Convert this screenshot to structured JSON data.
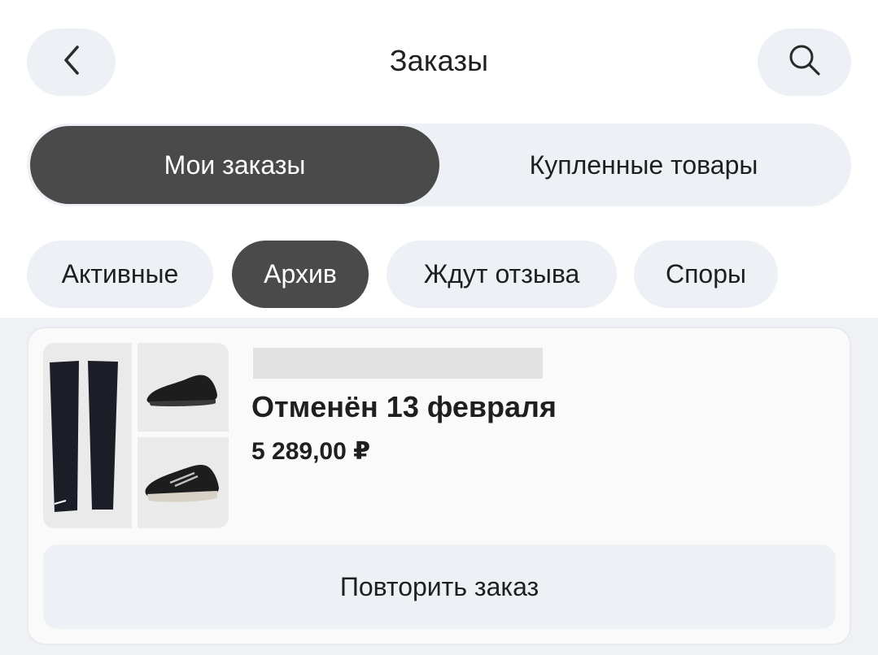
{
  "header": {
    "title": "Заказы",
    "back_icon": "chevron-left-icon",
    "search_icon": "search-icon"
  },
  "segment": {
    "items": [
      {
        "label": "Мои заказы",
        "selected": true
      },
      {
        "label": "Купленные товары",
        "selected": false
      }
    ]
  },
  "filters": {
    "chips": [
      {
        "label": "Активные",
        "selected": false
      },
      {
        "label": "Архив",
        "selected": true
      },
      {
        "label": "Ждут отзыва",
        "selected": false
      },
      {
        "label": "Споры",
        "selected": false
      }
    ]
  },
  "orders": [
    {
      "status": "Отменён 13 февраля",
      "price": "5 289,00 ₽",
      "repeat_label": "Повторить заказ"
    }
  ],
  "colors": {
    "accent_dark": "#4a4a4a",
    "chip_bg": "#edf1f5",
    "content_bg": "#eff1f4"
  }
}
